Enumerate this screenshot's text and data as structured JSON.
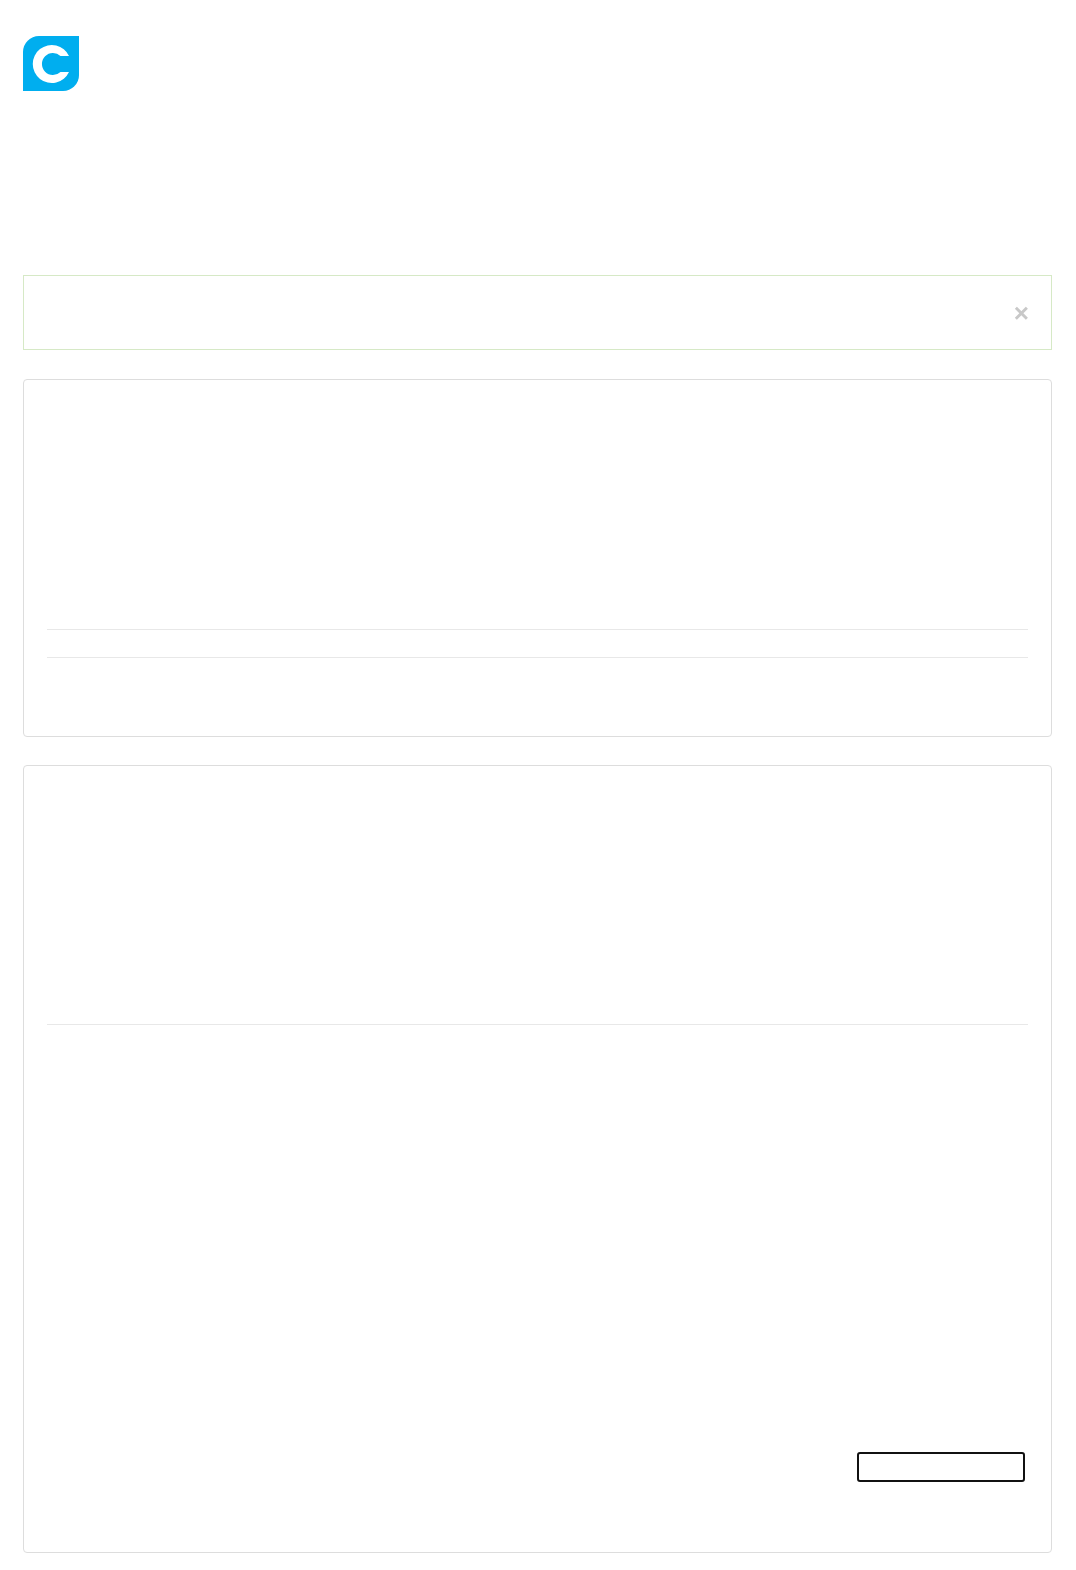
{
  "alert": {
    "close": "×"
  }
}
